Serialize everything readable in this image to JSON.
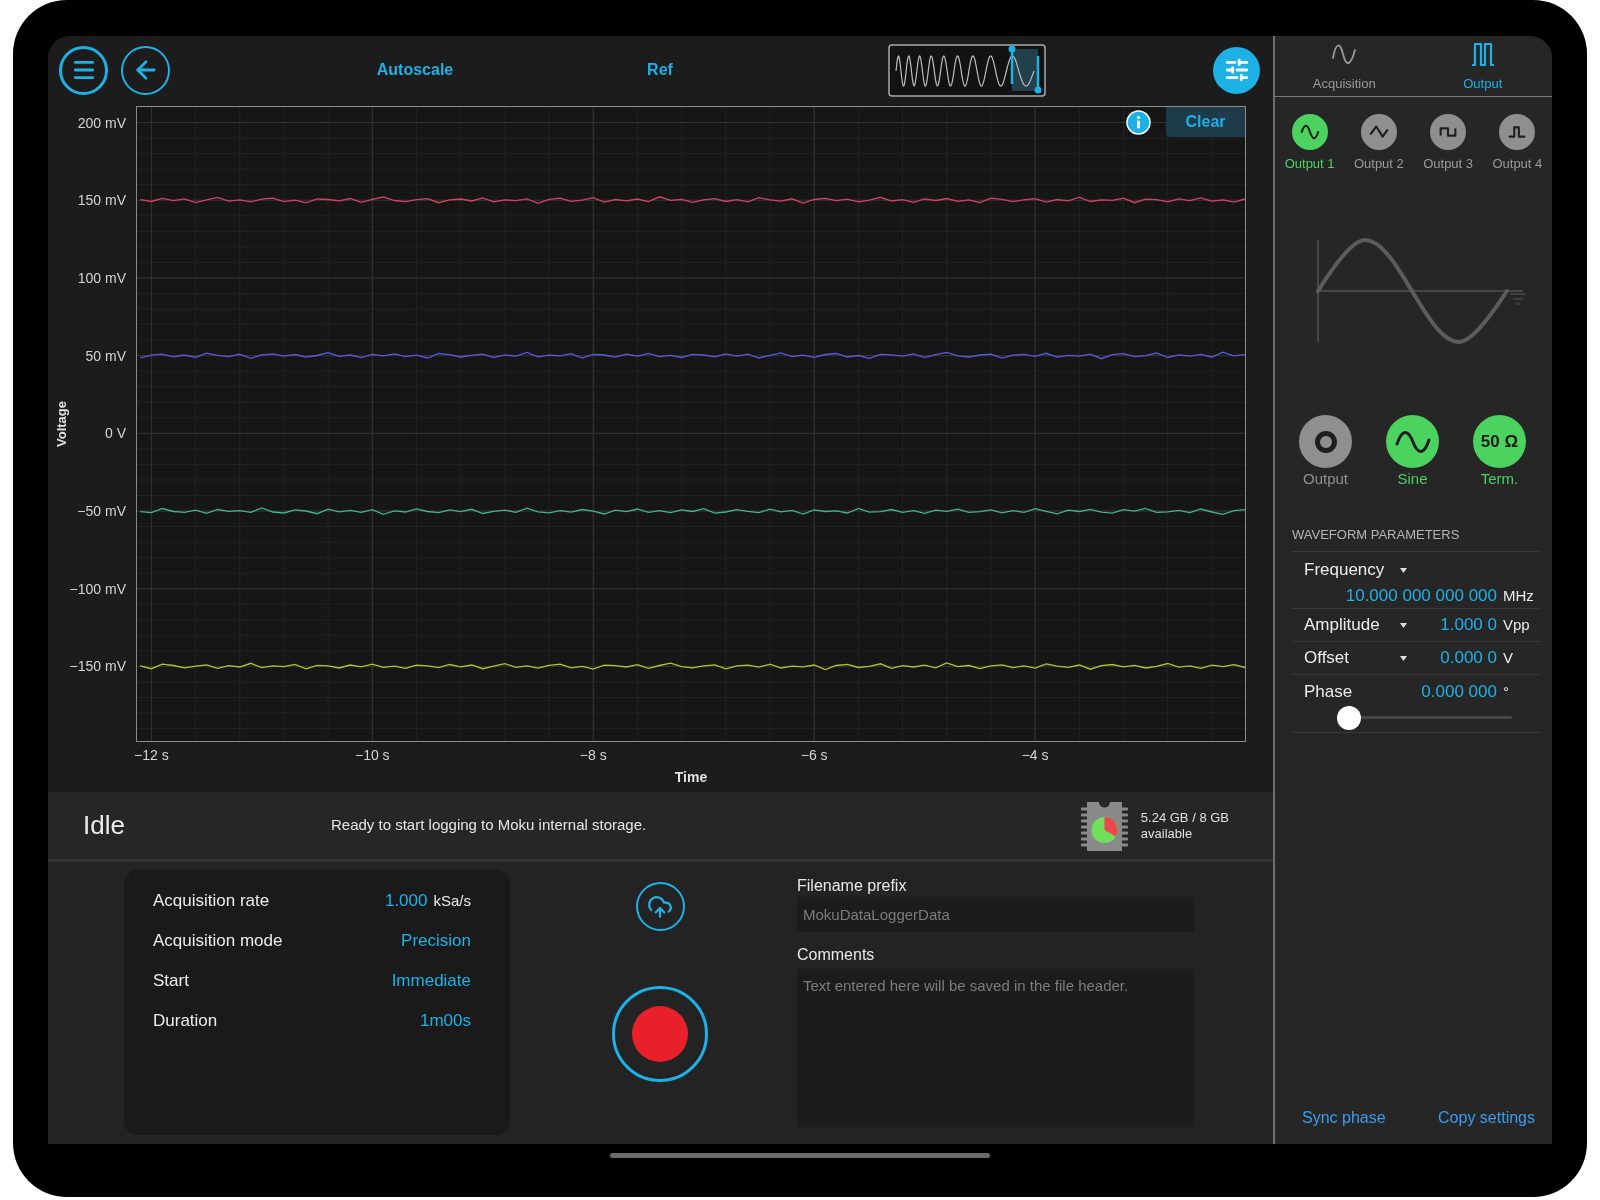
{
  "toolbar": {
    "actions": [
      {
        "label": "Autoscale"
      },
      {
        "label": "Ref"
      }
    ]
  },
  "plot": {
    "clear_button": "Clear",
    "chart_data": {
      "type": "line",
      "xlabel": "Time",
      "ylabel": "Voltage",
      "grid": true,
      "x": [
        -12.1,
        -12,
        -11.9,
        -11.8,
        -11.7,
        -11.6,
        -11.5,
        -11.4,
        -11.3,
        -11.2,
        -11.1,
        -11,
        -10.9,
        -10.8,
        -10.7,
        -10.6,
        -10.5,
        -10.4,
        -10.3,
        -10.2,
        -10.1,
        -10,
        -9.9,
        -9.8,
        -9.7,
        -9.6,
        -9.5,
        -9.4,
        -9.3,
        -9.2,
        -9.1,
        -9,
        -8.9,
        -8.8,
        -8.7,
        -8.6,
        -8.5,
        -8.4,
        -8.3,
        -8.2,
        -8.1,
        -8,
        -7.9,
        -7.8,
        -7.7,
        -7.6,
        -7.5,
        -7.4,
        -7.3,
        -7.2,
        -7.1,
        -7,
        -6.9,
        -6.8,
        -6.7,
        -6.6,
        -6.5,
        -6.4,
        -6.3,
        -6.2,
        -6.1,
        -6,
        -5.9,
        -5.8,
        -5.7,
        -5.6,
        -5.5,
        -5.4,
        -5.3,
        -5.2,
        -5.1,
        -5,
        -4.9,
        -4.8,
        -4.7,
        -4.6,
        -4.5,
        -4.4,
        -4.3,
        -4.2,
        -4.1,
        -4,
        -3.9,
        -3.8,
        -3.7,
        -3.6,
        -3.5,
        -3.4,
        -3.3,
        -3.2,
        -3.1,
        -3,
        -2.9,
        -2.8,
        -2.7,
        -2.6,
        -2.5,
        -2.4,
        -2.3,
        -2.2,
        -2.1
      ],
      "series": [
        {
          "color": "#d8435c",
          "values": [
            150.4,
            149.2,
            151.2,
            149.7,
            150.9,
            148.5,
            150.2,
            151.8,
            149.4,
            150.3,
            148.9,
            150.7,
            151.4,
            149.1,
            150.1,
            148.3,
            150.8,
            150.5,
            149.6,
            151.1,
            148.7,
            150.6,
            152.1,
            149.8,
            149.1,
            150.4,
            151.0,
            148.4,
            150.3,
            150.8,
            149.5,
            151.5,
            149.0,
            150.2,
            149.7,
            150.9,
            148.0,
            150.6,
            151.3,
            149.3,
            150.0,
            151.7,
            148.8,
            150.5,
            149.6,
            150.8,
            149.1,
            152.2,
            149.9,
            150.6,
            148.6,
            150.3,
            151.0,
            149.2,
            150.4,
            148.9,
            151.6,
            150.2,
            149.4,
            150.9,
            148.2,
            150.5,
            151.2,
            149.7,
            150.7,
            149.0,
            150.1,
            151.9,
            149.5,
            150.4,
            148.7,
            150.8,
            149.8,
            151.1,
            149.3,
            150.3,
            148.5,
            151.4,
            150.6,
            149.1,
            150.2,
            151.0,
            148.8,
            150.5,
            149.6,
            152.0,
            149.2,
            150.3,
            149.9,
            151.3,
            148.4,
            150.7,
            150.4,
            149.0,
            150.9,
            149.7,
            151.5,
            149.4,
            150.2,
            148.8,
            150.8
          ]
        },
        {
          "color": "#5a5ade",
          "values": [
            48.6,
            50.3,
            51.0,
            49.2,
            50.4,
            48.9,
            51.6,
            50.2,
            49.4,
            50.9,
            48.2,
            50.5,
            51.2,
            49.7,
            50.7,
            49.0,
            50.1,
            51.9,
            49.5,
            50.4,
            48.7,
            50.8,
            49.8,
            51.1,
            49.3,
            50.3,
            48.5,
            51.4,
            50.6,
            49.1,
            50.2,
            51.0,
            48.8,
            50.5,
            49.6,
            52.0,
            49.2,
            50.3,
            49.9,
            51.3,
            48.4,
            50.7,
            50.4,
            49.0,
            50.9,
            49.7,
            51.5,
            49.4,
            50.2,
            48.8,
            50.8,
            50.4,
            49.2,
            51.2,
            49.7,
            50.9,
            48.5,
            50.2,
            51.8,
            49.4,
            50.3,
            48.9,
            50.7,
            51.4,
            49.1,
            50.1,
            48.3,
            50.8,
            50.5,
            49.6,
            51.1,
            48.7,
            50.6,
            52.1,
            49.8,
            49.1,
            50.4,
            51.0,
            48.4,
            50.3,
            50.8,
            49.5,
            51.5,
            49.0,
            50.2,
            49.7,
            50.9,
            48.0,
            50.6,
            51.3,
            49.3,
            50.0,
            51.7,
            48.8,
            50.5,
            49.6,
            50.8,
            49.1,
            52.2,
            49.9,
            50.6
          ]
        },
        {
          "color": "#3fb48e",
          "values": [
            -50.4,
            -51.0,
            -48.4,
            -50.3,
            -50.8,
            -49.5,
            -51.5,
            -49.0,
            -50.2,
            -49.7,
            -50.9,
            -48.0,
            -50.6,
            -51.3,
            -49.3,
            -50.0,
            -51.7,
            -48.8,
            -50.5,
            -49.6,
            -50.8,
            -49.1,
            -52.2,
            -49.9,
            -50.6,
            -48.6,
            -50.3,
            -51.0,
            -49.2,
            -50.4,
            -48.9,
            -51.6,
            -50.2,
            -49.4,
            -50.9,
            -48.2,
            -50.5,
            -51.2,
            -49.7,
            -50.7,
            -49.0,
            -50.1,
            -51.9,
            -49.5,
            -50.4,
            -48.7,
            -50.8,
            -49.8,
            -51.1,
            -49.3,
            -50.3,
            -48.5,
            -51.4,
            -50.6,
            -49.1,
            -50.2,
            -51.0,
            -48.8,
            -50.5,
            -49.6,
            -52.0,
            -49.2,
            -50.3,
            -49.9,
            -51.3,
            -48.4,
            -50.7,
            -50.4,
            -49.0,
            -50.9,
            -49.7,
            -51.5,
            -49.4,
            -50.2,
            -48.8,
            -50.8,
            -50.4,
            -49.2,
            -51.2,
            -49.7,
            -50.9,
            -48.5,
            -50.2,
            -51.8,
            -49.4,
            -50.3,
            -48.9,
            -50.7,
            -51.4,
            -49.1,
            -50.1,
            -48.3,
            -50.8,
            -50.5,
            -49.6,
            -51.1,
            -48.7,
            -50.6,
            -52.1,
            -49.8,
            -49.1
          ]
        },
        {
          "color": "#b4c232",
          "values": [
            -149.7,
            -151.5,
            -148.6,
            -149.4,
            -150.9,
            -149.8,
            -149.0,
            -151.2,
            -149.5,
            -150.4,
            -148.0,
            -150.8,
            -149.7,
            -150.1,
            -148.7,
            -151.6,
            -149.3,
            -149.6,
            -151.0,
            -149.1,
            -150.3,
            -148.5,
            -150.6,
            -149.8,
            -151.2,
            -149.2,
            -149.6,
            -150.8,
            -148.8,
            -150.3,
            -149.1,
            -151.5,
            -149.8,
            -148.2,
            -150.6,
            -149.7,
            -151.1,
            -149.3,
            -148.6,
            -150.9,
            -149.9,
            -151.7,
            -149.2,
            -149.5,
            -150.4,
            -148.9,
            -151.3,
            -149.4,
            -147.9,
            -150.2,
            -150.9,
            -149.6,
            -149.0,
            -151.6,
            -149.7,
            -149.2,
            -150.5,
            -148.5,
            -151.0,
            -149.8,
            -150.3,
            -149.1,
            -152.0,
            -149.4,
            -148.7,
            -150.7,
            -150.0,
            -148.3,
            -151.2,
            -149.5,
            -150.4,
            -149.2,
            -150.9,
            -147.8,
            -150.1,
            -149.4,
            -151.4,
            -149.7,
            -149.0,
            -150.8,
            -149.6,
            -151.1,
            -148.4,
            -149.8,
            -150.6,
            -149.1,
            -151.8,
            -149.5,
            -148.8,
            -150.3,
            -149.3,
            -151.0,
            -149.9,
            -148.1,
            -150.5,
            -149.6,
            -151.3,
            -149.2,
            -150.2,
            -148.9,
            -150.7
          ]
        }
      ],
      "xlim": [
        -12.13,
        -2.1
      ],
      "ylim": [
        -198,
        210
      ],
      "xticks": [
        {
          "value": -12,
          "label": "−12 s"
        },
        {
          "value": -10,
          "label": "−10 s"
        },
        {
          "value": -8,
          "label": "−8 s"
        },
        {
          "value": -6,
          "label": "−6 s"
        },
        {
          "value": -4,
          "label": "−4 s"
        }
      ],
      "yticks": [
        {
          "value": 200,
          "label": "200 mV"
        },
        {
          "value": 150,
          "label": "150 mV"
        },
        {
          "value": 100,
          "label": "100 mV"
        },
        {
          "value": 50,
          "label": "50 mV"
        },
        {
          "value": 0,
          "label": "0 V"
        },
        {
          "value": -50,
          "label": "−50 mV"
        },
        {
          "value": -100,
          "label": "−100 mV"
        },
        {
          "value": -150,
          "label": "−150 mV"
        }
      ]
    }
  },
  "status_bar": {
    "state": "Idle",
    "message": "Ready to start logging to Moku internal storage.",
    "storage": {
      "amount": "5.24 GB / 8 GB",
      "label": "available"
    }
  },
  "logging": {
    "settings": [
      {
        "label": "Acquisition rate",
        "value": "1.000",
        "unit": "kSa/s"
      },
      {
        "label": "Acquisition mode",
        "value": "Precision"
      },
      {
        "label": "Start",
        "value": "Immediate"
      },
      {
        "label": "Duration",
        "value": "1m00s"
      }
    ],
    "filename": {
      "label": "Filename prefix",
      "placeholder": "MokuDataLoggerData"
    },
    "comments": {
      "label": "Comments",
      "placeholder": "Text entered here will be saved in the file header."
    }
  },
  "side_panel": {
    "tabs": [
      {
        "label": "Acquisition",
        "kind": "sine",
        "selected": false
      },
      {
        "label": "Output",
        "kind": "pulse",
        "selected": true
      }
    ],
    "outputs": [
      {
        "label": "Output 1",
        "kind": "sine",
        "selected": true
      },
      {
        "label": "Output 2",
        "kind": "triangle",
        "selected": false
      },
      {
        "label": "Output 3",
        "kind": "square",
        "selected": false
      },
      {
        "label": "Output 4",
        "kind": "pulse",
        "selected": false
      }
    ],
    "toggles": [
      {
        "kind": "output",
        "label": "Output",
        "on": false
      },
      {
        "kind": "sine",
        "label": "Sine",
        "on": true
      },
      {
        "kind": "termination",
        "label": "Term.",
        "badge": "50 Ω",
        "on": true
      }
    ],
    "parameters": {
      "title": "WAVEFORM PARAMETERS",
      "rows": [
        {
          "kind": "wide",
          "label": "Frequency",
          "value": "10.000 000 000 000",
          "unit": "MHz"
        },
        {
          "kind": "dropdown",
          "label": "Amplitude",
          "value": "1.000 0",
          "unit": "Vpp"
        },
        {
          "kind": "dropdown",
          "label": "Offset",
          "value": "0.000 0",
          "unit": "V"
        },
        {
          "kind": "slider",
          "label": "Phase",
          "value": "0.000 000",
          "unit": "°",
          "level": 0
        }
      ]
    },
    "links": [
      "Sync phase",
      "Copy settings"
    ]
  }
}
